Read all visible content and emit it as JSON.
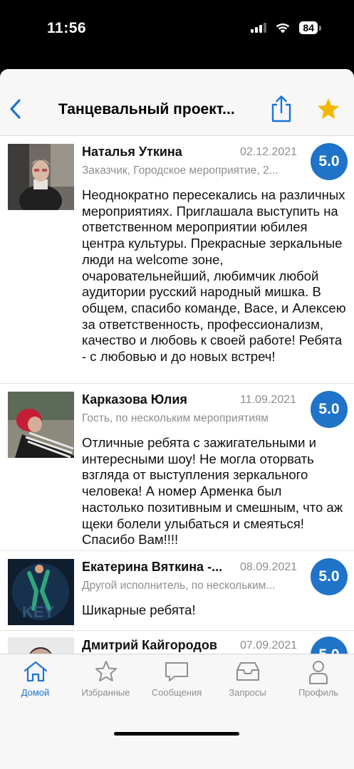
{
  "status": {
    "time": "11:56",
    "battery": "84"
  },
  "nav": {
    "title": "Танцевальный проект..."
  },
  "reviews": [
    {
      "name": "Наталья Уткина",
      "date": "02.12.2021",
      "role": "Заказчик, Городское мероприятие, 2...",
      "score": "5.0",
      "text": "Неоднократно пересекались на различных мероприятиях. Приглашала выступить на ответственном мероприятии юбилея центра культуры. Прекрасные зеркальные люди на welcome зоне, очаровательнейший, любимчик любой аудитории русский народный мишка. В общем, спасибо команде, Васе, и Алексею за ответственность, профессионализм, качество и любовь к своей работе! Ребята - с любовью и до новых встреч!"
    },
    {
      "name": "Карказова Юлия",
      "date": "11.09.2021",
      "role": "Гость, по нескольким мероприятиям",
      "score": "5.0",
      "text": "Отличные ребята с зажигательными и интересными шоу! Не могла оторвать взгляда от выступления зеркального человека! А номер Арменка был настолько позитивным и смешным, что аж щеки болели улыбаться и смеяться! Спасибо Вам!!!!"
    },
    {
      "name": "Екатерина Вяткина -...",
      "date": "08.09.2021",
      "role": "Другой исполнитель, по нескольким...",
      "score": "5.0",
      "text": "Шикарные ребята!"
    },
    {
      "name": "Дмитрий Кайгородов",
      "date": "07.09.2021",
      "role": "",
      "score": "5.0",
      "text": ""
    }
  ],
  "tabs": [
    {
      "label": "Домой",
      "icon": "home-icon",
      "active": true
    },
    {
      "label": "Избранные",
      "icon": "star-icon",
      "active": false
    },
    {
      "label": "Сообщения",
      "icon": "message-icon",
      "active": false
    },
    {
      "label": "Запросы",
      "icon": "inbox-icon",
      "active": false
    },
    {
      "label": "Профиль",
      "icon": "profile-icon",
      "active": false
    }
  ],
  "colors": {
    "accent": "#1b74d8",
    "score_bg": "#1f73c8",
    "star": "#f5b800"
  }
}
